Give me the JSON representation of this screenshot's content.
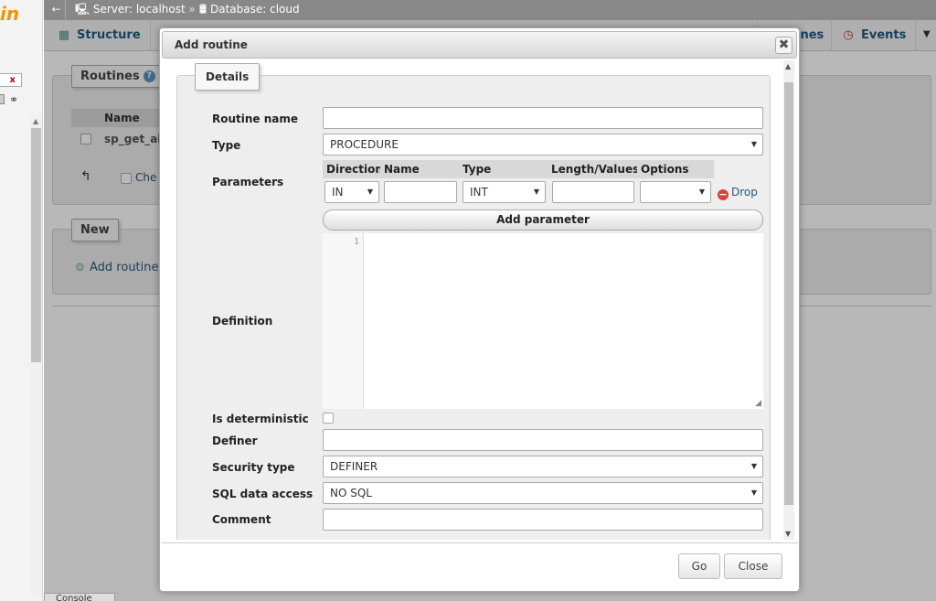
{
  "left_panel": {
    "logo_fragment": "in",
    "filter_clear": "x"
  },
  "breadcrumb": {
    "server": "Server: localhost",
    "separator": "»",
    "database": "Database: cloud"
  },
  "tabs": {
    "structure": "Structure",
    "routines": "ines",
    "events": "Events"
  },
  "routines_section": {
    "legend": "Routines",
    "column_name": "Name",
    "row_name": "sp_get_al",
    "check_all": "Che"
  },
  "new_section": {
    "legend": "New",
    "add_routine": "Add routine"
  },
  "console": {
    "label": "Console"
  },
  "dialog": {
    "title": "Add routine",
    "close_glyph": "✖",
    "details_legend": "Details",
    "fields": {
      "routine_name": {
        "label": "Routine name",
        "value": ""
      },
      "type": {
        "label": "Type",
        "value": "PROCEDURE"
      },
      "parameters": {
        "label": "Parameters",
        "headers": [
          "Direction",
          "Name",
          "Type",
          "Length/Values",
          "Options"
        ],
        "row": {
          "direction": "IN",
          "name": "",
          "type": "INT",
          "length": "",
          "options": ""
        },
        "drop_label": "Drop",
        "add_label": "Add parameter"
      },
      "definition": {
        "label": "Definition",
        "line_number": "1",
        "value": ""
      },
      "is_deterministic": {
        "label": "Is deterministic",
        "checked": false
      },
      "definer": {
        "label": "Definer",
        "value": ""
      },
      "security_type": {
        "label": "Security type",
        "value": "DEFINER"
      },
      "sql_data_access": {
        "label": "SQL data access",
        "value": "NO SQL"
      },
      "comment": {
        "label": "Comment",
        "value": ""
      }
    },
    "buttons": {
      "go": "Go",
      "close": "Close"
    }
  }
}
